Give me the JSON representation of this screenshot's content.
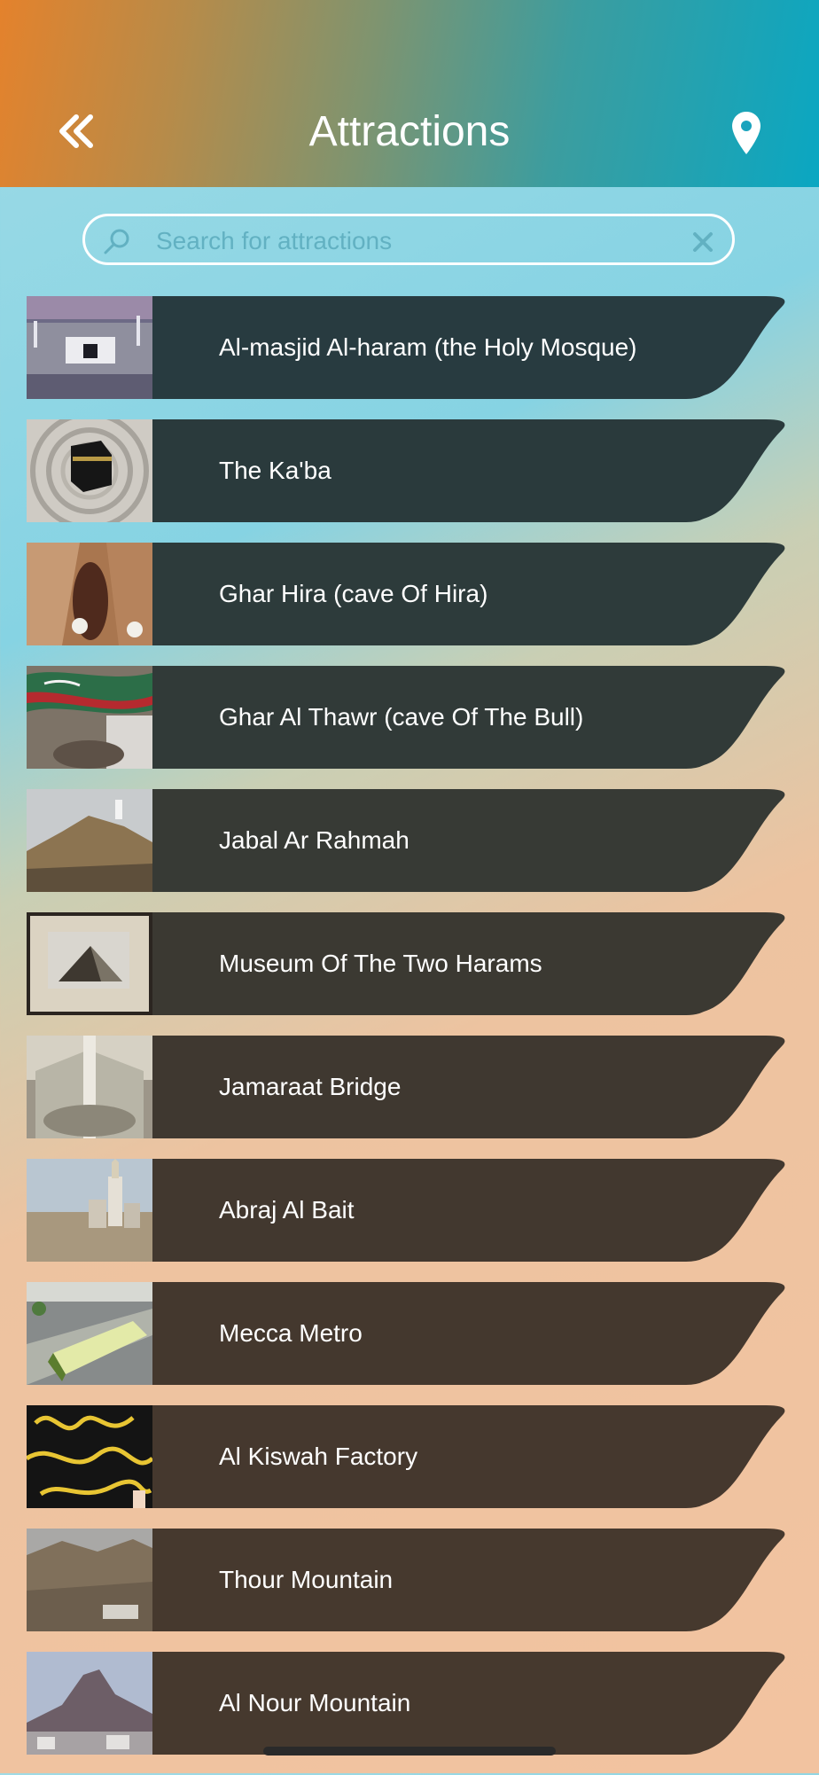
{
  "header": {
    "title": "Attractions",
    "back_icon": "double-chevron-left-icon",
    "location_icon": "map-pin-icon"
  },
  "search": {
    "placeholder": "Search for attractions",
    "value": ""
  },
  "attractions": [
    {
      "name": "Al-masjid Al-haram (the Holy Mosque)",
      "thumb": "mosque-photo",
      "color": "#283b40"
    },
    {
      "name": "The Ka'ba",
      "thumb": "kaaba-photo",
      "color": "#2a3a3c"
    },
    {
      "name": "Ghar Hira (cave Of Hira)",
      "thumb": "cave-photo",
      "color": "#2d3b3b"
    },
    {
      "name": "Ghar Al Thawr (cave Of The Bull)",
      "thumb": "flag-photo",
      "color": "#313a38"
    },
    {
      "name": "Jabal Ar Rahmah",
      "thumb": "hill-photo",
      "color": "#373a35"
    },
    {
      "name": "Museum Of The Two Harams",
      "thumb": "museum-photo",
      "color": "#3b3932"
    },
    {
      "name": "Jamaraat Bridge",
      "thumb": "bridge-photo",
      "color": "#3f3830"
    },
    {
      "name": "Abraj Al Bait",
      "thumb": "tower-photo",
      "color": "#42382f"
    },
    {
      "name": "Mecca Metro",
      "thumb": "metro-photo",
      "color": "#44382e"
    },
    {
      "name": "Al Kiswah Factory",
      "thumb": "kiswah-photo",
      "color": "#45382e"
    },
    {
      "name": "Thour Mountain",
      "thumb": "mountain-photo",
      "color": "#46392e"
    },
    {
      "name": "Al Nour Mountain",
      "thumb": "nour-mountain-photo",
      "color": "#46392e"
    }
  ]
}
